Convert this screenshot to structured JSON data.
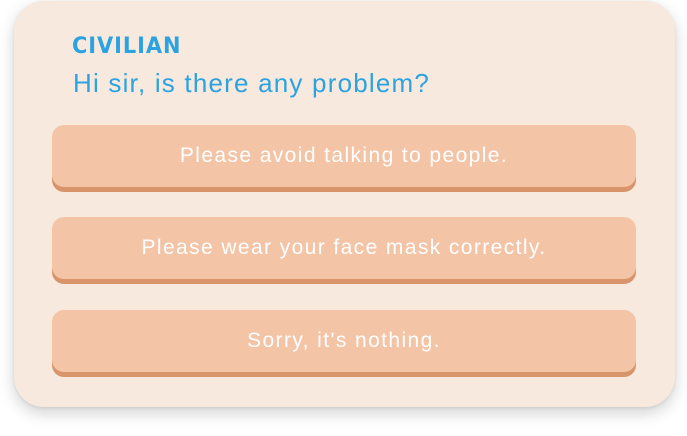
{
  "dialog": {
    "speaker": "CIVILIAN",
    "line": "Hi sir, is there any problem?"
  },
  "choices": [
    {
      "label": "Please avoid talking to people."
    },
    {
      "label": "Please wear your face mask correctly."
    },
    {
      "label": "Sorry, it's nothing."
    }
  ],
  "colors": {
    "card_background": "#f7e9de",
    "speaker_text": "#2aa3e0",
    "choice_fill": "#f4c4a6",
    "choice_shadow": "#d8946a",
    "choice_text": "#ffffff"
  }
}
